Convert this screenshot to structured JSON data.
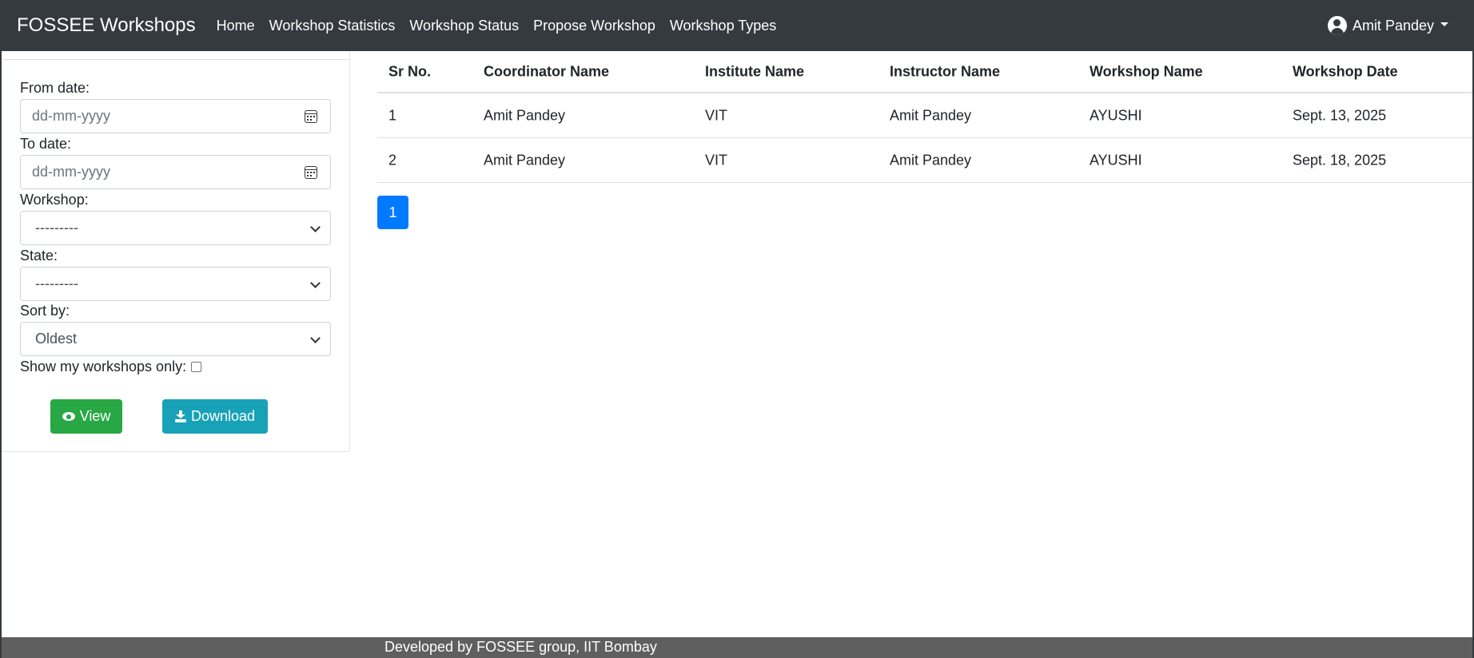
{
  "navbar": {
    "brand": "FOSSEE Workshops",
    "links": [
      "Home",
      "Workshop Statistics",
      "Workshop Status",
      "Propose Workshop",
      "Workshop Types"
    ],
    "user": "Amit Pandey"
  },
  "filters": {
    "from_label": "From date:",
    "from_placeholder": "dd-mm-yyyy",
    "to_label": "To date:",
    "to_placeholder": "dd-mm-yyyy",
    "workshop_label": "Workshop:",
    "workshop_value": "---------",
    "state_label": "State:",
    "state_value": "---------",
    "sort_label": "Sort by:",
    "sort_value": "Oldest",
    "mine_label": "Show my workshops only:",
    "mine_checked": false,
    "view_label": "View",
    "download_label": "Download"
  },
  "table": {
    "headers": [
      "Sr No.",
      "Coordinator Name",
      "Institute Name",
      "Instructor Name",
      "Workshop Name",
      "Workshop Date"
    ],
    "rows": [
      [
        "1",
        "Amit Pandey",
        "VIT",
        "Amit Pandey",
        "AYUSHI",
        "Sept. 13, 2025"
      ],
      [
        "2",
        "Amit Pandey",
        "VIT",
        "Amit Pandey",
        "AYUSHI",
        "Sept. 18, 2025"
      ]
    ]
  },
  "pagination": {
    "current": "1"
  },
  "footer": {
    "text": "Developed by FOSSEE group, IIT Bombay"
  },
  "colors": {
    "navbar": "#343a40",
    "view_button": "#28a745",
    "download_button": "#17a2b8",
    "pagination_active": "#007bff",
    "footer": "#5f5f5f"
  }
}
